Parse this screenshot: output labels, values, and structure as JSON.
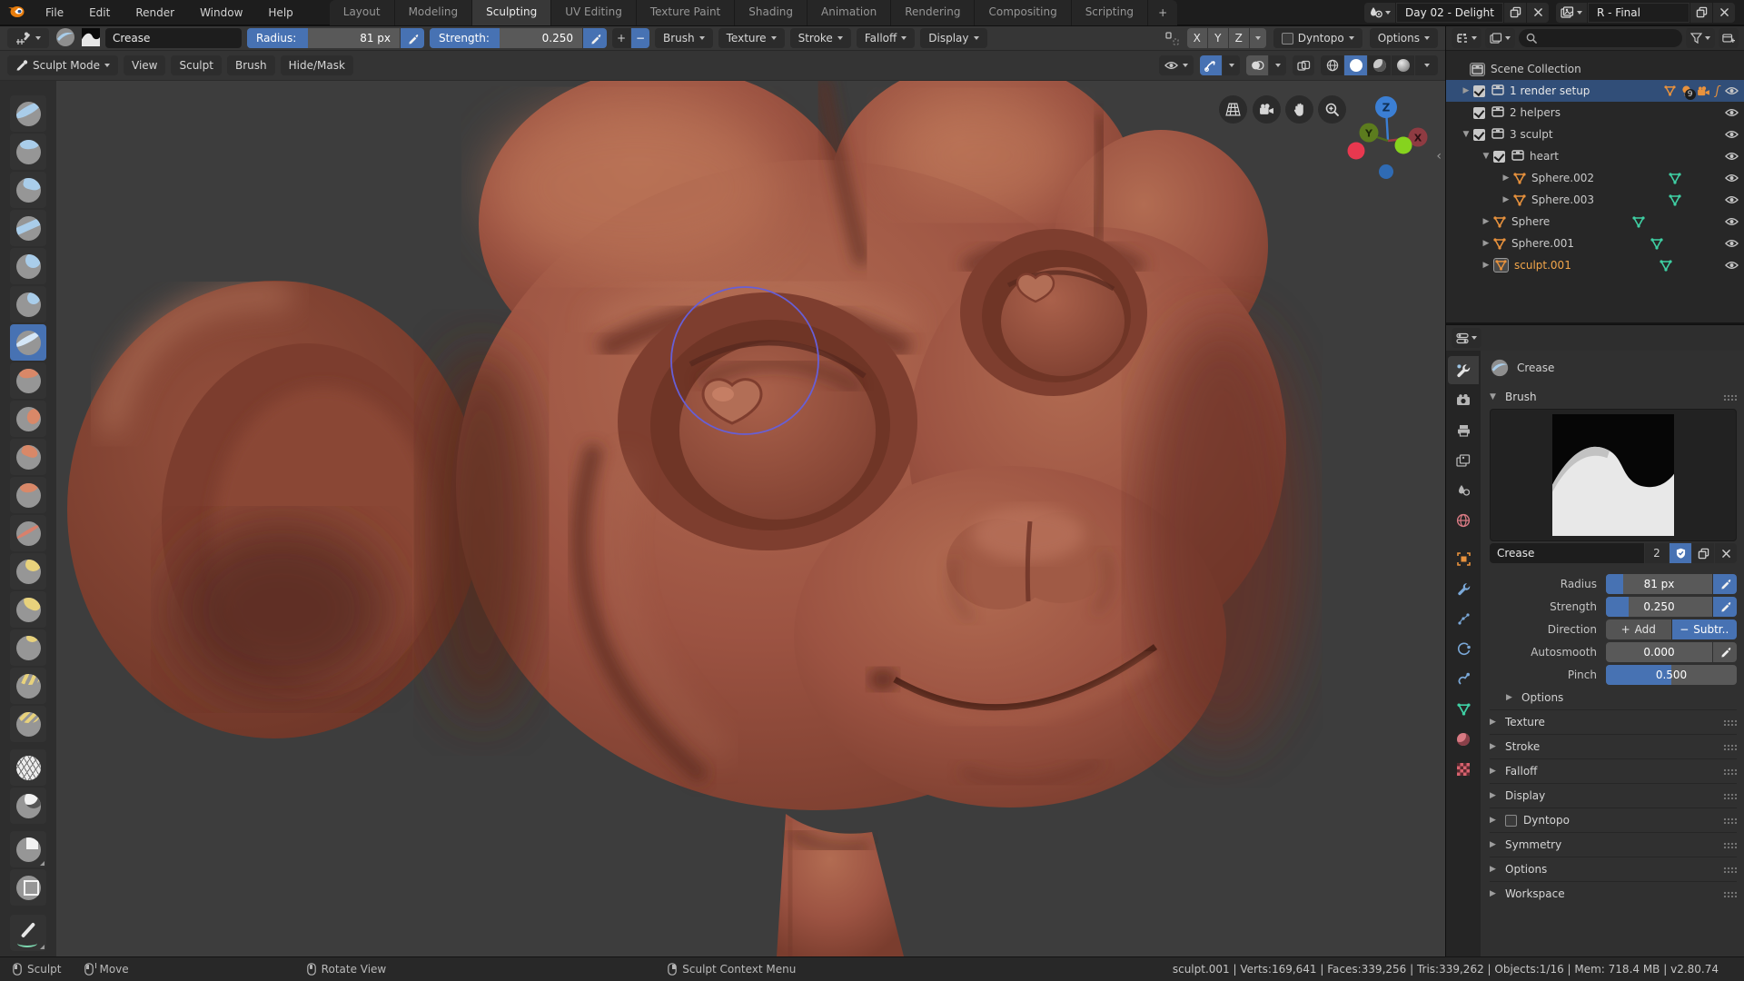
{
  "topbar": {
    "menus": [
      "File",
      "Edit",
      "Render",
      "Window",
      "Help"
    ],
    "tabs": [
      "Layout",
      "Modeling",
      "Sculpting",
      "UV Editing",
      "Texture Paint",
      "Shading",
      "Animation",
      "Rendering",
      "Compositing",
      "Scripting"
    ],
    "active_tab": "Sculpting",
    "add_tab": "+",
    "scene": {
      "value": "Day 02 - Delight"
    },
    "view_layer": {
      "value": "R - Final"
    }
  },
  "tool_settings": {
    "brush_name": "Crease",
    "radius_label": "Radius:",
    "radius_value": "81 px",
    "strength_label": "Strength:",
    "strength_value": "0.250",
    "plus": "+",
    "minus": "−",
    "menus": [
      "Brush",
      "Texture",
      "Stroke",
      "Falloff",
      "Display"
    ],
    "symmetry_axes": [
      "X",
      "Y",
      "Z"
    ],
    "dyntopo_label": "Dyntopo",
    "options_label": "Options"
  },
  "viewport": {
    "mode": "Sculpt Mode",
    "menus": [
      "View",
      "Sculpt",
      "Brush",
      "Hide/Mask"
    ],
    "axis_labels": {
      "x": "X",
      "y": "Y",
      "z": "Z"
    },
    "collapse_arrow": "‹"
  },
  "toolbar": {
    "tools": [
      "draw",
      "clay",
      "clay-strips",
      "layer",
      "inflate",
      "blob",
      "crease",
      "smooth",
      "flatten",
      "fill",
      "scrape",
      "pinch",
      "grab",
      "snake-hook",
      "thumb",
      "nudge",
      "rotate",
      "simplify",
      "mask",
      "box-mask",
      "box-hide",
      "annotate"
    ],
    "active_tool": "crease"
  },
  "outliner": {
    "root_label": "Scene Collection",
    "items": [
      {
        "label": "1 render setup",
        "badge": "9"
      },
      {
        "label": "2 helpers"
      },
      {
        "label": "3 sculpt"
      },
      {
        "label": "heart"
      },
      {
        "label": "Sphere.002"
      },
      {
        "label": "Sphere.003"
      },
      {
        "label": "Sphere"
      },
      {
        "label": "Sphere.001"
      },
      {
        "label": "sculpt.001"
      }
    ]
  },
  "properties": {
    "breadcrumb": "Crease",
    "brush_panel_label": "Brush",
    "name_field": {
      "value": "Crease",
      "users": "2"
    },
    "radius": {
      "label": "Radius",
      "value": "81 px"
    },
    "strength": {
      "label": "Strength",
      "value": "0.250"
    },
    "direction": {
      "label": "Direction",
      "plus": "+",
      "add": "Add",
      "minus": "−",
      "subtract": "Subtr.."
    },
    "autosmooth": {
      "label": "Autosmooth",
      "value": "0.000"
    },
    "pinch": {
      "label": "Pinch",
      "value": "0.500"
    },
    "options_subpanel": "Options",
    "panels": [
      "Texture",
      "Stroke",
      "Falloff",
      "Display",
      "Dyntopo",
      "Symmetry",
      "Options",
      "Workspace"
    ]
  },
  "statusbar": {
    "items": [
      "Sculpt",
      "Move",
      "Rotate View",
      "Sculpt Context Menu"
    ],
    "info": "sculpt.001 | Verts:169,641 | Faces:339,256 | Tris:339,262 | Objects:1/16 | Mem: 718.4 MB | v2.80.74"
  },
  "colors": {
    "accent": "#4772b3",
    "selection_row": "#314e78",
    "object_orange": "#e8923d",
    "mesh_data_green": "#3fd0a4",
    "active_object_text": "#f3a64b",
    "axis_x": "#c0383f",
    "axis_y": "#5c7c1e",
    "axis_z": "#3b7fd4",
    "brush_cursor": "#675fd6",
    "sculpt_skin": "#9c5342"
  }
}
